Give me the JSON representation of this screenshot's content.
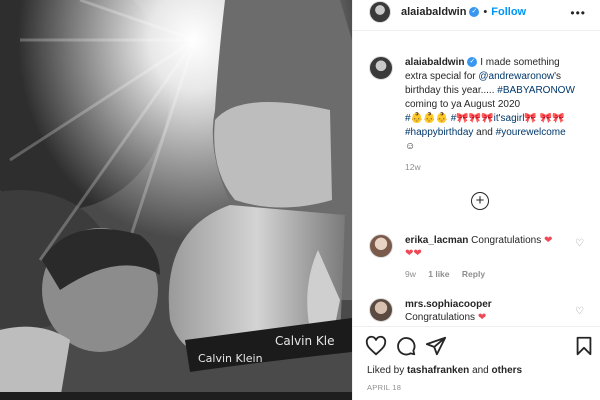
{
  "post": {
    "username": "alaiabaldwin",
    "follow_label": "Follow",
    "more_label": "•••",
    "separator": "•"
  },
  "caption": {
    "username": "alaiabaldwin",
    "line1": "I made something extra special for",
    "mention": "@andrewaronow",
    "line2": "'s birthday this year.....",
    "tag_baby": "#BABYARONOW",
    "line3": "coming to ya August 2020",
    "emoji_line_start": "#👶👶👶 #🎀🎀🎀it'sagirl🎀 🎀🎀",
    "tag_birthday": "#happybirthday",
    "and": "and",
    "tag_welcome": "#yourewelcome",
    "smile": "☺",
    "time": "12w"
  },
  "comments": [
    {
      "username": "erika_lacman",
      "text": "Congratulations",
      "hearts": "❤",
      "hearts_line2": "❤❤",
      "time": "9w",
      "likes": "1 like",
      "reply": "Reply"
    },
    {
      "username": "mrs.sophiacooper",
      "text": "Congratulations",
      "hearts": "❤"
    }
  ],
  "actions": {
    "liked_by_prefix": "Liked by",
    "liked_by_user": "tashafranken",
    "liked_by_suffix": "and",
    "liked_by_others": "others",
    "date": "APRIL 18"
  },
  "photo": {
    "brand_text_1": "Calvin Klein",
    "brand_text_2": "Calvin Kle"
  }
}
